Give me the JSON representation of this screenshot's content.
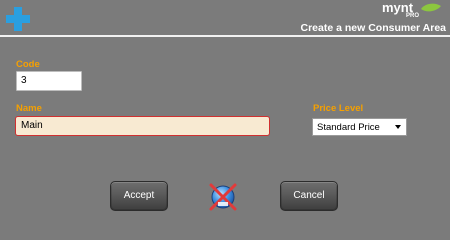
{
  "header": {
    "logo_text": "mynt",
    "logo_sub": "PRO",
    "title": "Create a new Consumer Area",
    "plus_icon": "plus-icon",
    "leaf_icon": "leaf-icon"
  },
  "form": {
    "code": {
      "label": "Code",
      "value": "3"
    },
    "name": {
      "label": "Name",
      "value": "Main"
    },
    "price_level": {
      "label": "Price Level",
      "selected": "Standard Price"
    }
  },
  "actions": {
    "accept_label": "Accept",
    "cancel_label": "Cancel",
    "delete_icon": "delete-disabled-icon"
  },
  "colors": {
    "background": "#7b7b7b",
    "label": "#f5a000",
    "plus": "#2a9fe0",
    "error_border": "#d03030",
    "name_fill": "#f8ead2"
  }
}
